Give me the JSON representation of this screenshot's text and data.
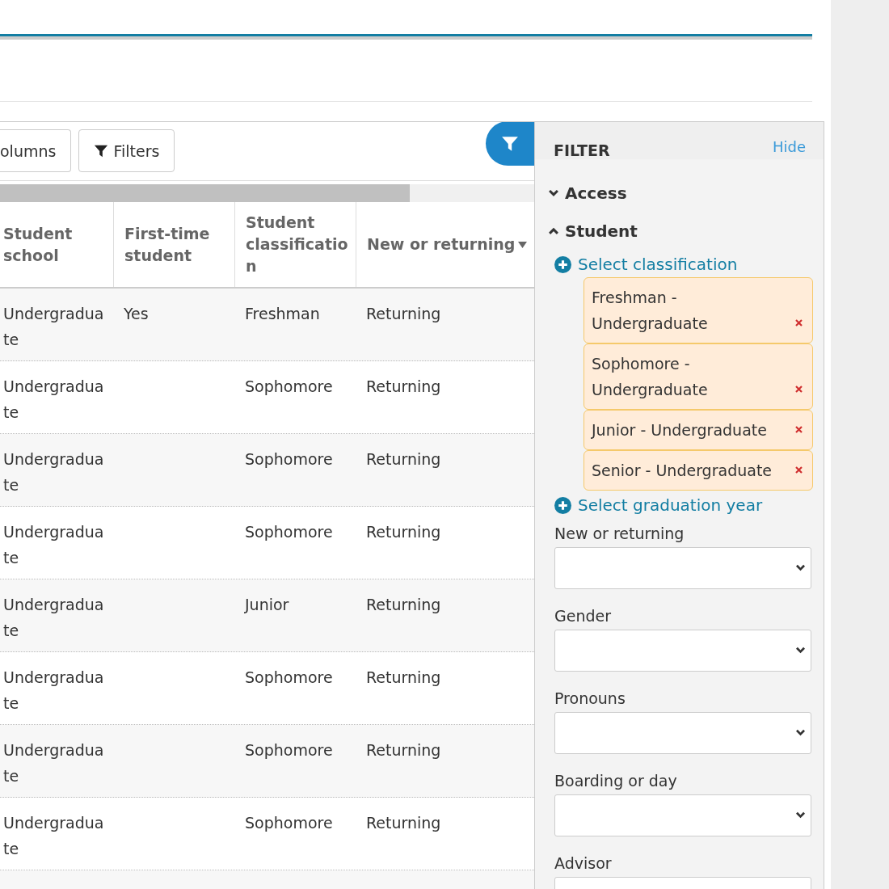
{
  "toolbar": {
    "buttons": [
      {
        "label": "olumns",
        "kind": "plain"
      },
      {
        "label": "Filters",
        "kind": "filter"
      }
    ]
  },
  "table": {
    "columns": [
      {
        "label": "Student school",
        "sorted": false
      },
      {
        "label": "First-time student",
        "sorted": false
      },
      {
        "label": "Student classification",
        "sorted": false
      },
      {
        "label": "New or returning",
        "sorted": true
      }
    ],
    "rows": [
      {
        "school": "Undergraduate",
        "first_time": "Yes",
        "classification": "Freshman",
        "status": "Returning"
      },
      {
        "school": "Undergraduate",
        "classification": "Sophomore",
        "status": "Returning"
      },
      {
        "school": "Undergraduate",
        "classification": "Sophomore",
        "status": "Returning"
      },
      {
        "school": "Undergraduate",
        "classification": "Sophomore",
        "status": "Returning"
      },
      {
        "school": "Undergraduate",
        "classification": "Junior",
        "status": "Returning"
      },
      {
        "school": "Undergraduate",
        "classification": "Sophomore",
        "status": "Returning"
      },
      {
        "school": "Undergraduate",
        "classification": "Sophomore",
        "status": "Returning"
      },
      {
        "school": "Undergraduate",
        "classification": "Sophomore",
        "status": "Returning"
      }
    ]
  },
  "filter_panel": {
    "title": "FILTER",
    "hide_link": "Hide",
    "sections": [
      {
        "label": "Access",
        "expanded": false
      },
      {
        "label": "Student",
        "expanded": true,
        "pickers": [
          {
            "label": "Select classification",
            "chips": [
              "Freshman - Undergraduate",
              "Sophomore - Undergraduate",
              "Junior - Undergraduate",
              "Senior - Undergraduate"
            ]
          },
          {
            "label": "Select graduation year"
          }
        ],
        "fields": [
          {
            "label": "New or returning"
          },
          {
            "label": "Gender"
          },
          {
            "label": "Pronouns"
          },
          {
            "label": "Boarding or day"
          },
          {
            "label": "Advisor"
          }
        ]
      }
    ]
  }
}
